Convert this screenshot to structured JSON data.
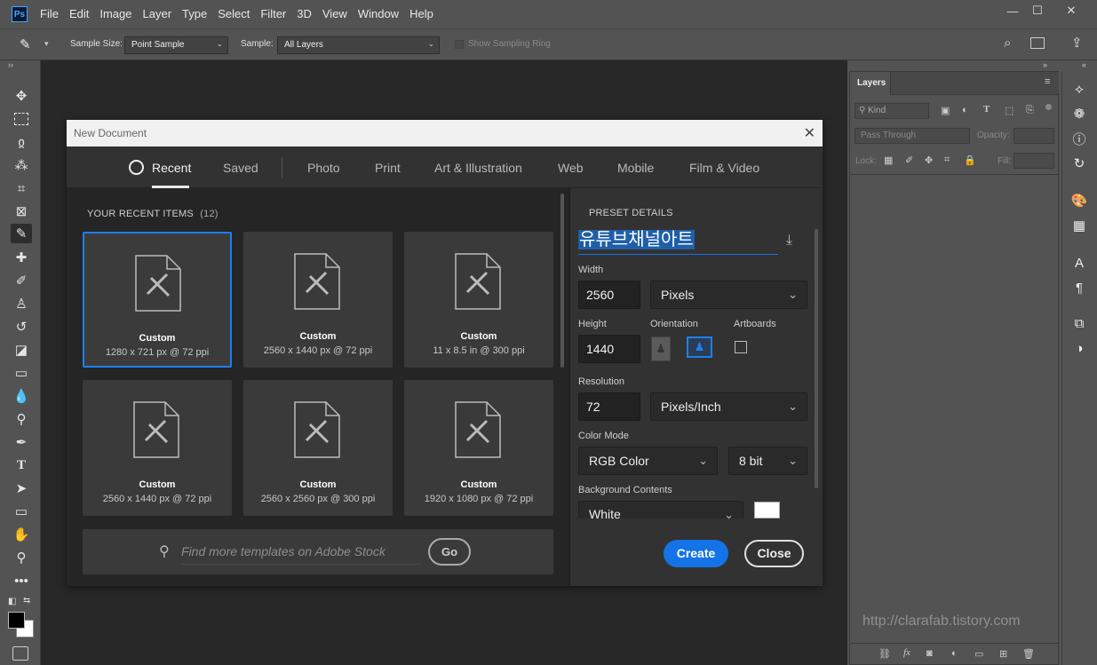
{
  "app": {
    "logo": "Ps"
  },
  "menu": [
    "File",
    "Edit",
    "Image",
    "Layer",
    "Type",
    "Select",
    "Filter",
    "3D",
    "View",
    "Window",
    "Help"
  ],
  "window_controls": {
    "minimize": "—",
    "maximize": "☐",
    "close": "✕"
  },
  "options_bar": {
    "sample_size_label": "Sample Size:",
    "sample_size_value": "Point Sample",
    "sample_label": "Sample:",
    "sample_value": "All Layers",
    "show_ring_label": "Show Sampling Ring"
  },
  "dialog": {
    "title": "New Document",
    "tabs": [
      "Recent",
      "Saved",
      "Photo",
      "Print",
      "Art & Illustration",
      "Web",
      "Mobile",
      "Film & Video"
    ],
    "active_tab": "Recent",
    "recent_title": "YOUR RECENT ITEMS",
    "recent_count": "(12)",
    "items": [
      {
        "name": "Custom",
        "info": "1280 x 721 px @ 72 ppi"
      },
      {
        "name": "Custom",
        "info": "2560 x 1440 px @ 72 ppi"
      },
      {
        "name": "Custom",
        "info": "11 x 8.5 in @ 300 ppi"
      },
      {
        "name": "Custom",
        "info": "2560 x 1440 px @ 72 ppi"
      },
      {
        "name": "Custom",
        "info": "2560 x 2560 px @ 300 ppi"
      },
      {
        "name": "Custom",
        "info": "1920 x 1080 px @ 72 ppi"
      }
    ],
    "search_placeholder": "Find more templates on Adobe Stock",
    "go_label": "Go",
    "preset": {
      "section_title": "PRESET DETAILS",
      "name": "유튜브채널아트",
      "width_label": "Width",
      "width_value": "2560",
      "width_unit": "Pixels",
      "height_label": "Height",
      "height_value": "1440",
      "orientation_label": "Orientation",
      "artboards_label": "Artboards",
      "resolution_label": "Resolution",
      "resolution_value": "72",
      "resolution_unit": "Pixels/Inch",
      "color_mode_label": "Color Mode",
      "color_mode_value": "RGB Color",
      "bit_depth": "8 bit",
      "background_label": "Background Contents",
      "background_value": "White"
    },
    "create_label": "Create",
    "close_label": "Close"
  },
  "layers_panel": {
    "tab": "Layers",
    "kind_label": "Kind",
    "blend_mode": "Pass Through",
    "opacity_label": "Opacity:",
    "lock_label": "Lock:",
    "fill_label": "Fill:"
  },
  "watermark": "http://clarafab.tistory.com",
  "colors": {
    "accent": "#1473e6",
    "selection": "#1d7ff0"
  }
}
